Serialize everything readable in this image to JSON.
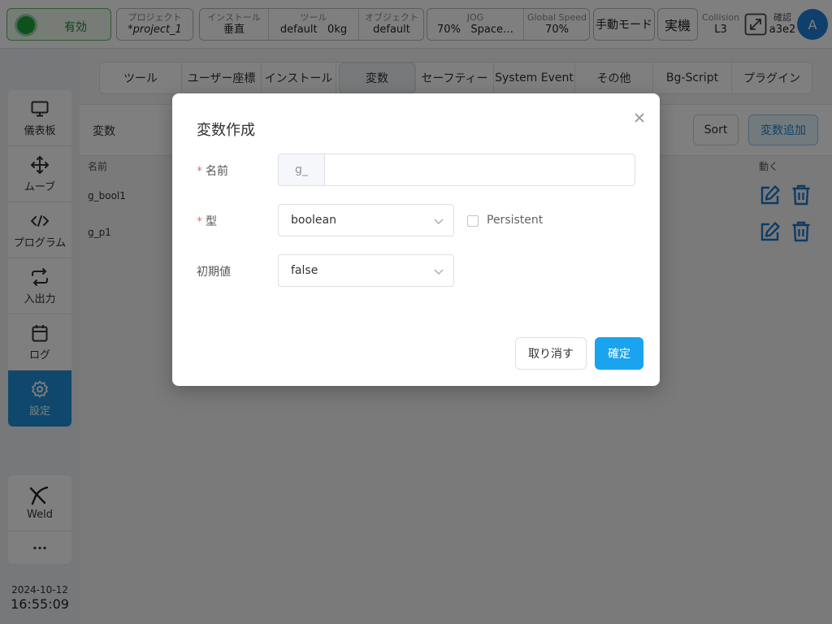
{
  "topbar": {
    "status": "有効",
    "project_label": "プロジェクト",
    "project_value": "*project_1",
    "install_label": "インストール",
    "install_value": "垂直",
    "tool_label": "ツール",
    "tool_value": "default",
    "tool_weight": "0kg",
    "object_label": "オブジェクト",
    "object_value": "default",
    "jog_label": "JOG",
    "jog_value": "70%",
    "jog_space": "Space…",
    "speed_label": "Global Speed",
    "speed_value": "70%",
    "mode_label": "手動モード",
    "real_label": "実機",
    "collision_label": "Collision",
    "collision_value": "L3",
    "confirm_label": "確認",
    "confirm_value": "a3e2",
    "avatar_letter": "A"
  },
  "sidebar": {
    "items": [
      {
        "label": "儀表板",
        "icon": "monitor-icon"
      },
      {
        "label": "ムーブ",
        "icon": "move-arrows-icon"
      },
      {
        "label": "プログラム",
        "icon": "code-icon"
      },
      {
        "label": "入出力",
        "icon": "swap-icon"
      },
      {
        "label": "ログ",
        "icon": "calendar-icon"
      },
      {
        "label": "設定",
        "icon": "gear-icon"
      }
    ],
    "active_index": 5,
    "weld_label": "Weld",
    "more_label": "···",
    "date": "2024-10-12",
    "time": "16:55:09"
  },
  "tabs": [
    "ツール",
    "ユーザー座標",
    "インストール",
    "変数",
    "セーフティー",
    "System Event",
    "その他",
    "Bg-Script",
    "プラグイン"
  ],
  "active_tab": "変数",
  "toolbar": {
    "title": "変数",
    "sort_label": "Sort",
    "add_label": "変数追加"
  },
  "table": {
    "col_name": "名前",
    "col_action": "動く",
    "rows": [
      "g_bool1",
      "g_p1"
    ]
  },
  "modal": {
    "title": "変数作成",
    "name_label": "名前",
    "name_prefix": "g_",
    "name_value": "",
    "type_label": "型",
    "type_value": "boolean",
    "persistent_label": "Persistent",
    "persistent_checked": false,
    "init_label": "初期値",
    "init_value": "false",
    "cancel_label": "取り消す",
    "ok_label": "確定"
  },
  "colors": {
    "accent": "#1aa3ee",
    "active_nav": "#1e90d8",
    "status_green": "#1ea23a",
    "icon_blue": "#1a78c8",
    "required": "#f56c6c"
  }
}
